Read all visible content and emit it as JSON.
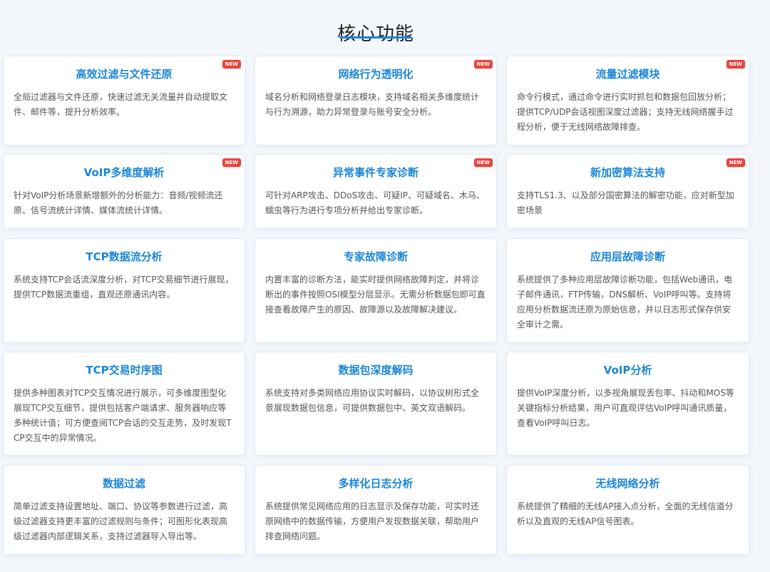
{
  "page": {
    "title": "核心功能"
  },
  "cards": [
    {
      "title": "高效过滤与文件还原",
      "desc": "全局过滤器与文件还原，快速过滤无关流量并自动提取文件、邮件等，提升分析效率。",
      "badge": "NEW"
    },
    {
      "title": "网络行为透明化",
      "desc": "域名分析和网络登录日志模块，支持域名相关多维度统计与行为溯源，助力异常登录与账号安全分析。",
      "badge": "NEW"
    },
    {
      "title": "流量过滤模块",
      "desc": "命令行模式，通过命令进行实时抓包和数据包回放分析；提供TCP/UDP会话视图深度过滤器；支持无线网络握手过程分析，便于无线网络故障排查。",
      "badge": "NEW"
    },
    {
      "title": "VoIP多维度解析",
      "desc": "针对VoIP分析场景新增额外的分析能力：音频/视频流还原、信号流统计详情、媒体流统计详情。",
      "badge": "NEW"
    },
    {
      "title": "异常事件专家诊断",
      "desc": "可针对ARP攻击、DDoS攻击、可疑IP、可疑域名、木马、蠕虫等行为进行专项分析并给出专家诊断。",
      "badge": "NEW"
    },
    {
      "title": "新加密算法支持",
      "desc": "支持TLS1.3、以及部分国密算法的解密功能，应对新型加密场景",
      "badge": "NEW"
    },
    {
      "title": "TCP数据流分析",
      "desc": "系统支持TCP会话流深度分析，对TCP交易细节进行展现，提供TCP数据流重组，直观还原通讯内容。",
      "badge": ""
    },
    {
      "title": "专家故障诊断",
      "desc": "内置丰富的诊断方法，能实时提供网络故障判定，并将诊断出的事件按照OSI模型分层显示。无需分析数据包即可直接查看故障产生的原因、故障源以及故障解决建议。",
      "badge": ""
    },
    {
      "title": "应用层故障诊断",
      "desc": "系统提供了多种应用层故障诊断功能，包括Web通讯，电子邮件通讯，FTP传输，DNS解析、VoIP呼叫等。支持将应用分析数据流还原为原始信息，并以日志形式保存供安全审计之需。",
      "badge": ""
    },
    {
      "title": "TCP交易时序图",
      "desc": "提供多种图表对TCP交互情况进行展示，可多维度图型化展现TCP交互细节，提供包括客户端请求、服务器响应等多种统计值；可方便查阅TCP会话的交互走势，及时发现TCP交互中的异常情况。",
      "badge": ""
    },
    {
      "title": "数据包深度解码",
      "desc": "系统支持对多类网络应用协议实时解码，以协议树形式全景展现数据包信息，可提供数据包中、英文双语解码。",
      "badge": ""
    },
    {
      "title": "VoIP分析",
      "desc": "提供VoIP深度分析，以多视角展现丢包率、抖动和MOS等关键指标分析结果，用户可直观评估VoIP呼叫通讯质量，查看VoIP呼叫日志。",
      "badge": ""
    },
    {
      "title": "数据过滤",
      "desc": "简单过滤支持设置地址、端口、协议等参数进行过滤，高级过滤器支持更丰富的过滤规则与条件；可图形化表现高级过滤器内部逻辑关系，支持过滤器导入导出等。",
      "badge": ""
    },
    {
      "title": "多样化日志分析",
      "desc": "系统提供常见网络应用的日志显示及保存功能，可实时还原网络中的数据传输，方便用户发现数据关联，帮助用户排查网络问题。",
      "badge": ""
    },
    {
      "title": "无线网络分析",
      "desc": "系统提供了精细的无线AP接入点分析，全面的无线信道分析以及直观的无线AP信号图表。",
      "badge": ""
    }
  ]
}
